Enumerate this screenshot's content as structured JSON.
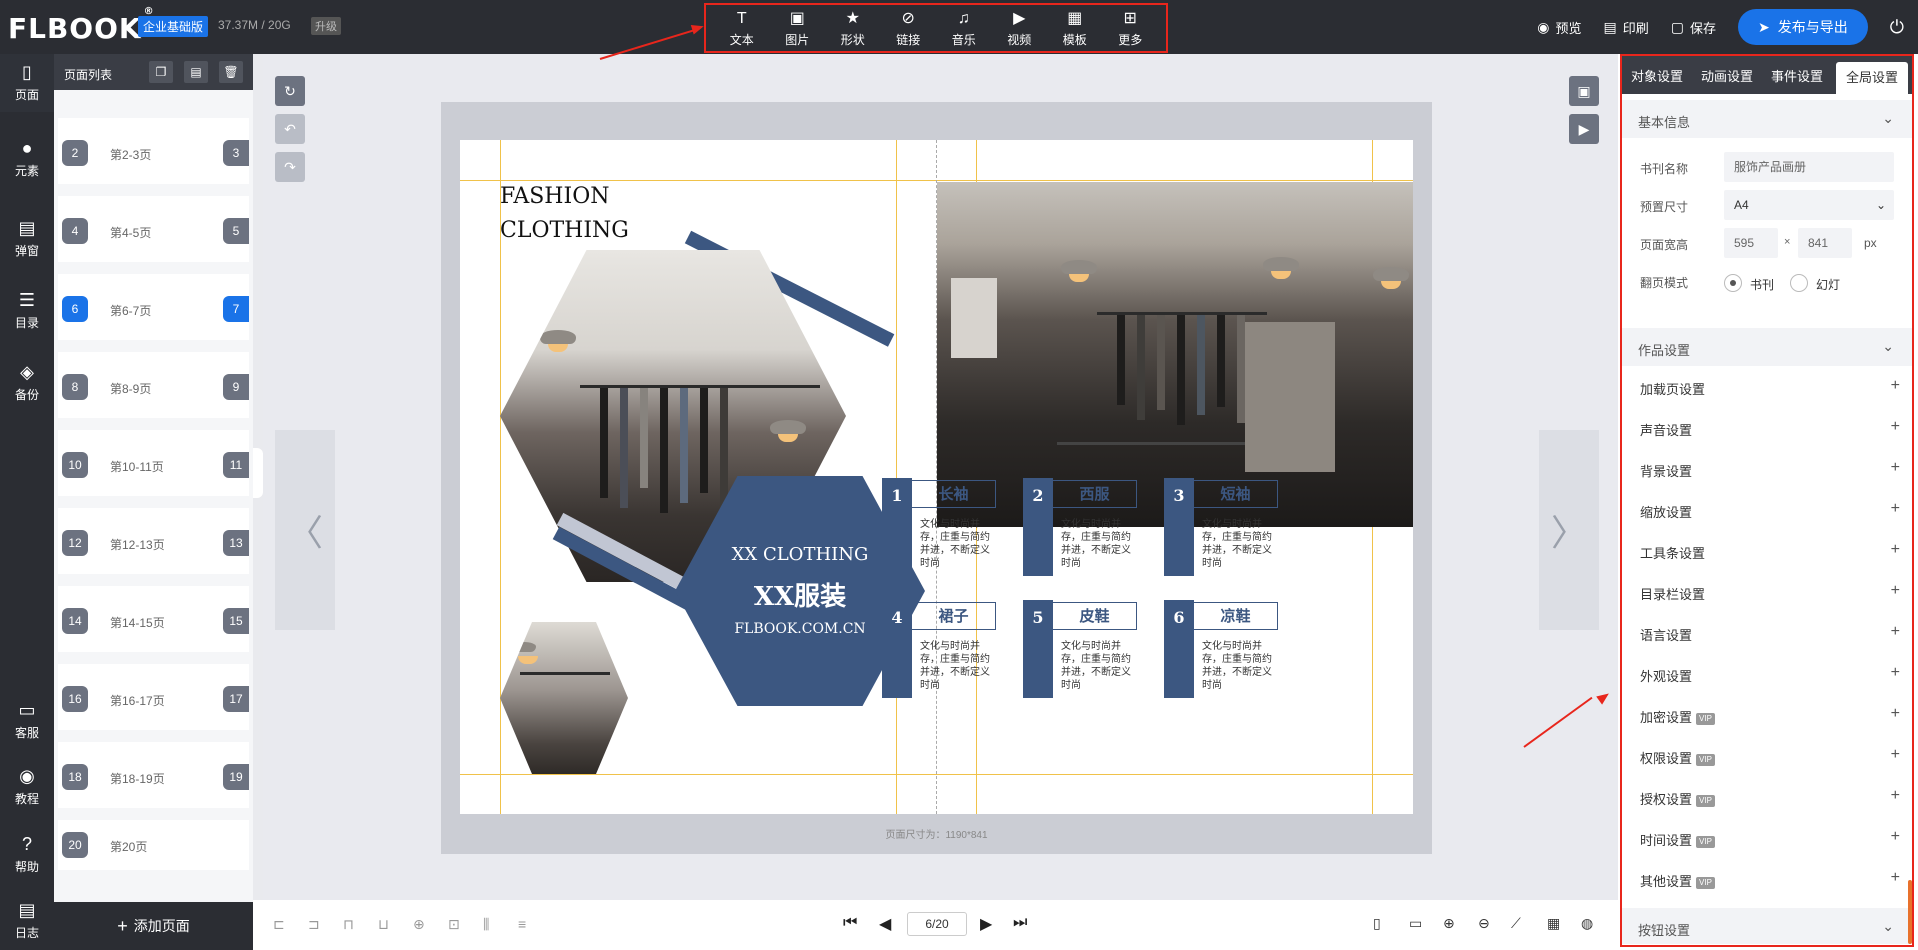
{
  "app": {
    "logo": "FLBOOK",
    "logo_mark": "®",
    "edition": "企业基础版",
    "storage": "37.37M / 20G",
    "upgrade": "升级"
  },
  "toolbar": {
    "items": [
      {
        "label": "文本",
        "icon": "text-icon"
      },
      {
        "label": "图片",
        "icon": "image-icon"
      },
      {
        "label": "形状",
        "icon": "star-icon"
      },
      {
        "label": "链接",
        "icon": "link-icon"
      },
      {
        "label": "音乐",
        "icon": "music-icon"
      },
      {
        "label": "视频",
        "icon": "video-icon"
      },
      {
        "label": "模板",
        "icon": "template-icon"
      },
      {
        "label": "更多",
        "icon": "more-icon"
      }
    ]
  },
  "header_actions": {
    "preview": "预览",
    "print": "印刷",
    "save": "保存",
    "publish": "发布与导出"
  },
  "leftnav": {
    "items": [
      {
        "label": "页面",
        "icon": "page-icon"
      },
      {
        "label": "元素",
        "icon": "elements-icon"
      },
      {
        "label": "弹窗",
        "icon": "popup-icon"
      },
      {
        "label": "目录",
        "icon": "list-icon"
      },
      {
        "label": "备份",
        "icon": "layers-icon"
      }
    ],
    "bottom": [
      {
        "label": "客服",
        "icon": "chat-icon"
      },
      {
        "label": "教程",
        "icon": "play-circle-icon"
      },
      {
        "label": "帮助",
        "icon": "help-icon"
      },
      {
        "label": "日志",
        "icon": "log-icon"
      }
    ]
  },
  "pagelist": {
    "title": "页面列表",
    "items": [
      {
        "left": "2",
        "label": "第2-3页",
        "right": "3",
        "active": false
      },
      {
        "left": "4",
        "label": "第4-5页",
        "right": "5",
        "active": false
      },
      {
        "left": "6",
        "label": "第6-7页",
        "right": "7",
        "active": true
      },
      {
        "left": "8",
        "label": "第8-9页",
        "right": "9",
        "active": false
      },
      {
        "left": "10",
        "label": "第10-11页",
        "right": "11",
        "active": false
      },
      {
        "left": "12",
        "label": "第12-13页",
        "right": "13",
        "active": false
      },
      {
        "left": "14",
        "label": "第14-15页",
        "right": "15",
        "active": false
      },
      {
        "left": "16",
        "label": "第16-17页",
        "right": "17",
        "active": false
      },
      {
        "left": "18",
        "label": "第18-19页",
        "right": "19",
        "active": false
      },
      {
        "left": "20",
        "label": "第20页",
        "right": "",
        "active": false
      }
    ],
    "add_page": "添加页面"
  },
  "book": {
    "page_size_text": "页面尺寸为：1190*841",
    "fashion_line1": "FASHION",
    "fashion_line2": "CLOTHING",
    "brand_en": "XX CLOTHING",
    "brand_cn": "XX服装",
    "website": "FLBOOK.COM.CN",
    "cards": [
      {
        "num": "1",
        "name": "长袖",
        "desc": "文化与时尚并存，庄重与简约并进，不断定义时尚"
      },
      {
        "num": "2",
        "name": "西服",
        "desc": "文化与时尚并存，庄重与简约并进，不断定义时尚"
      },
      {
        "num": "3",
        "name": "短袖",
        "desc": "文化与时尚并存，庄重与简约并进，不断定义时尚"
      },
      {
        "num": "4",
        "name": "裙子",
        "desc": "文化与时尚并存，庄重与简约并进，不断定义时尚"
      },
      {
        "num": "5",
        "name": "皮鞋",
        "desc": "文化与时尚并存，庄重与简约并进，不断定义时尚"
      },
      {
        "num": "6",
        "name": "凉鞋",
        "desc": "文化与时尚并存，庄重与简约并进，不断定义时尚"
      }
    ]
  },
  "pager": {
    "current": "6/20"
  },
  "rightpanel": {
    "tabs": [
      "对象设置",
      "动画设置",
      "事件设置",
      "全局设置"
    ],
    "active_tab": "全局设置",
    "basic_info": {
      "title": "基本信息",
      "book_name_label": "书刊名称",
      "book_name_value": "服饰产品画册",
      "preset_size_label": "预置尺寸",
      "preset_size_value": "A4",
      "page_size_label": "页面宽高",
      "width": "595",
      "height": "841",
      "unit": "px",
      "times": "×",
      "flip_mode_label": "翻页模式",
      "mode_book": "书刊",
      "mode_slide": "幻灯"
    },
    "work_settings": {
      "title": "作品设置",
      "items": [
        {
          "label": "加载页设置",
          "vip": false
        },
        {
          "label": "声音设置",
          "vip": false
        },
        {
          "label": "背景设置",
          "vip": false
        },
        {
          "label": "缩放设置",
          "vip": false
        },
        {
          "label": "工具条设置",
          "vip": false
        },
        {
          "label": "目录栏设置",
          "vip": false
        },
        {
          "label": "语言设置",
          "vip": false
        },
        {
          "label": "外观设置",
          "vip": false
        },
        {
          "label": "加密设置",
          "vip": true
        },
        {
          "label": "权限设置",
          "vip": true
        },
        {
          "label": "授权设置",
          "vip": true
        },
        {
          "label": "时间设置",
          "vip": true
        },
        {
          "label": "其他设置",
          "vip": true
        }
      ],
      "vip_badge": "VIP"
    },
    "button_settings": "按钮设置"
  },
  "colors": {
    "accent": "#1a73e8",
    "dark": "#2b2d33",
    "navy": "#3c5781",
    "highlight": "#e8261c"
  }
}
